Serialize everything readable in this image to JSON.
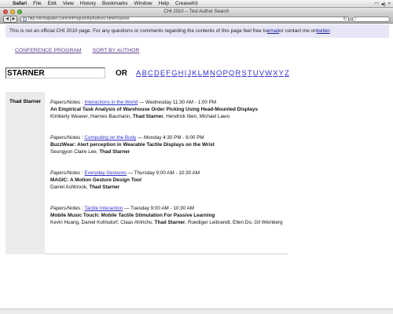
{
  "menubar": {
    "apple": "",
    "items": [
      "Safari",
      "File",
      "Edit",
      "View",
      "History",
      "Bookmarks",
      "Window",
      "Help",
      "CreaseKit"
    ]
  },
  "window": {
    "title": "CHI 2010 -- Test Author Search",
    "url": "http://nirmalpatel.com/chiProgram/byAuthors.html#Starner"
  },
  "notice": {
    "text_before": "This is not an official CHI 2010 page. For any questions or comments regarding the contents of this page feel free to ",
    "email_label": "email",
    "text_middle": " or contact me on ",
    "twitter_label": "twitter",
    "text_after": "."
  },
  "nav": {
    "conference_program": "CONFERENCE PROGRAM",
    "sort_by_author": "SORT BY AUTHOR"
  },
  "search": {
    "value": "STARNER",
    "or_label": "OR",
    "letters": [
      "A",
      "B",
      "C",
      "D",
      "E",
      "F",
      "G",
      "H",
      "I",
      "J",
      "K",
      "L",
      "M",
      "N",
      "O",
      "P",
      "Q",
      "R",
      "S",
      "T",
      "U",
      "V",
      "W",
      "X",
      "Y",
      "Z"
    ]
  },
  "author": {
    "name": "Thad Starner"
  },
  "entries": [
    {
      "type": "Papers/Notes",
      "session": "Interactions in the World",
      "time": "— Wednesday 11:30 AM - 1:00 PM",
      "title": "An Empirical Task Analysis of Warehouse Order Picking Using Head-Mounted Displays",
      "authors_before": "Kimberly Weaver, Hannes Baumann, ",
      "author_highlight": "Thad Starner",
      "authors_after": ", Hendrick Iben, Michael Lawo"
    },
    {
      "type": "Papers/Notes",
      "session": "Computing on the Body",
      "time": "— Monday 4:30 PM - 6:00 PM",
      "title": "BuzzWear: Alert perception in Wearable Tactile Displays on the Wrist",
      "authors_before": "Seungyon Claire Lee, ",
      "author_highlight": "Thad Starner",
      "authors_after": ""
    },
    {
      "type": "Papers/Notes",
      "session": "Everyday Gestures",
      "time": "— Thursday 9:00 AM - 10:30 AM",
      "title": "MAGIC: A Motion Gesture Design Tool",
      "authors_before": "Daniel Ashbrook, ",
      "author_highlight": "Thad Starner",
      "authors_after": ""
    },
    {
      "type": "Papers/Notes",
      "session": "Tactile Interaction",
      "time": "— Tuesday 9:00 AM - 10:30 AM",
      "title": "Mobile Music Touch: Mobile Tactile Stimulation For Passive Learning",
      "authors_before": "Kevin Huang, Daniel Kohlsdorf, Claas Ahlrichs, ",
      "author_highlight": "Thad Starner",
      "authors_after": ", Ruediger Leibrandt, Ellen Do, Gil Weinberg"
    }
  ]
}
